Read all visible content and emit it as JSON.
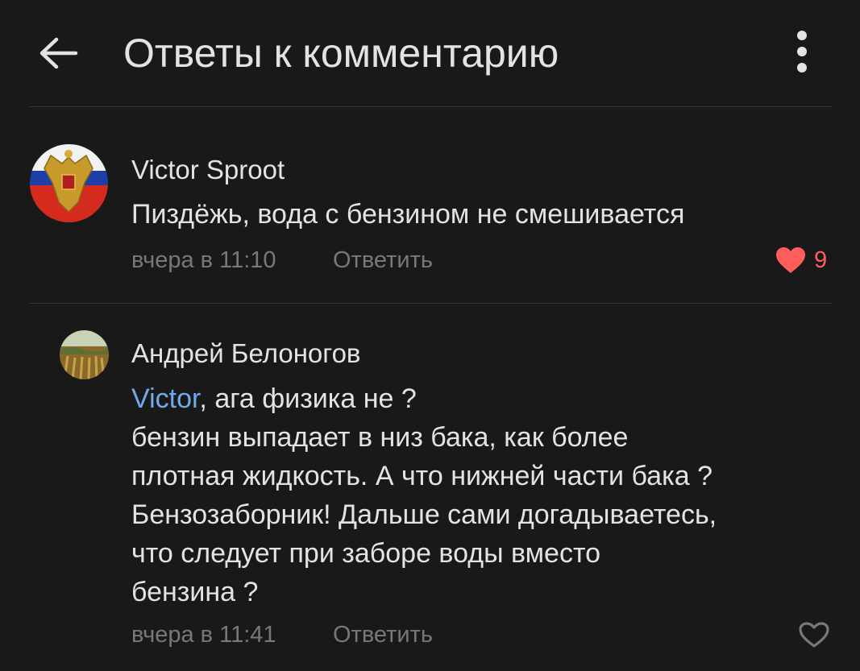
{
  "header": {
    "title": "Ответы к комментарию",
    "back_icon": "arrow-left-icon",
    "more_icon": "more-vertical-icon"
  },
  "comments": [
    {
      "author": "Victor Sproot",
      "text": "Пиздёжь, вода с бензином не смешивается",
      "time": "вчера в 11:10",
      "reply_label": "Ответить",
      "likes": "9",
      "liked": true,
      "avatar_icon": "coat-of-arms-avatar"
    },
    {
      "author": "Андрей Белоногов",
      "mention": "Victor",
      "text_lines": [
        ", ага физика не ?",
        "бензин выпадает в низ бака, как более",
        "плотная жидкость. А что нижней части бака ?",
        "Бензозаборник! Дальше сами догадываетесь,",
        "что следует при заборе воды вместо",
        "бензина ?"
      ],
      "time": "вчера в 11:41",
      "reply_label": "Ответить",
      "liked": false,
      "avatar_icon": "landscape-avatar"
    }
  ],
  "colors": {
    "background": "#19191a",
    "text": "#e1e3e6",
    "secondary": "#76787a",
    "link": "#71aaeb",
    "like_active": "#ff5c5c"
  }
}
